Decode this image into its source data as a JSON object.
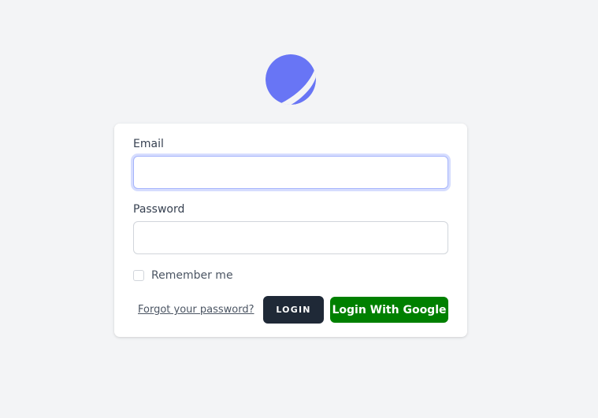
{
  "brand": {
    "logo_icon": "planet-logo-icon",
    "logo_color": "#6875f5"
  },
  "login_form": {
    "email_label": "Email",
    "email_value": "",
    "password_label": "Password",
    "password_value": "",
    "remember_label": "Remember me",
    "remember_checked": false,
    "forgot_link": "Forgot your password?",
    "login_button": "LOGIN",
    "google_button": "Login With Google"
  },
  "colors": {
    "page_background": "#f3f4f6",
    "login_button": "#1f2937",
    "google_button": "#008000",
    "focus_ring": "#a5b4fc"
  }
}
